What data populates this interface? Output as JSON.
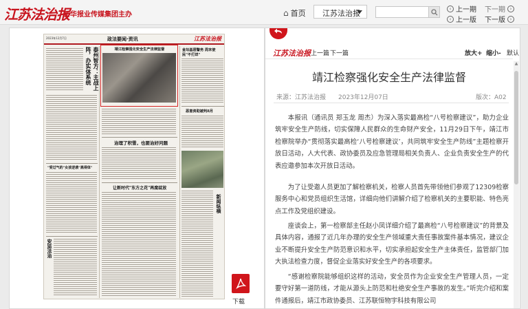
{
  "header": {
    "logo_text": "江苏法治报",
    "brand_text": "新华报业传媒集团主办",
    "home_label": "首页",
    "paper_select_value": "江苏法治报",
    "search_placeholder": "",
    "nav": {
      "prev_page": "上一期",
      "next_page": "下一期",
      "prev_edition": "上一版",
      "next_edition": "下一版"
    }
  },
  "newspaper": {
    "date_line": "2023年12月7日",
    "section_title": "政法要闻·资讯",
    "logo": "江苏法治报",
    "headlines": [
      "靖江检察强化安全生产法律监督",
      "金坛基层警务 周末使民\"不打烊\"",
      "恶意资助被判8月",
      "治理了积雪，也要治好问题",
      "让新时代\"东方之花\"再度绽放",
      "\"受过气的\"女孩逆袭\"高得体\"",
      "泰州智方：主战上阵，办实体系统",
      "安监法治",
      "新闻纵横"
    ]
  },
  "pdf": {
    "label": "下载"
  },
  "reader": {
    "logo": "江苏法治报",
    "prev_label": "上一篇",
    "next_label": "下一篇",
    "zoom_in": "放大+",
    "zoom_out": "缩小-",
    "zoom_default": "默认",
    "title": "靖江检察强化安全生产法律监督",
    "source": "来源：江苏法治报",
    "date": "2023年12月07日",
    "edition": "版次：A02",
    "paragraphs": [
      "本报讯（通讯员 郑玉龙 周杰）为深入落实最高检“八号检察建议”，助力企业筑牢安全生产防线，切实保障人民群众的生命财产安全，11月29日下午，靖江市检察院举办“贯彻落实最高检‘八号检察建议’，共同筑牢安全生产防线”主题检察开放日活动，人大代表、政协委员及应急管理局相关负责人、企业负责安全生产的代表应邀参加本次开放日活动。",
      "为了让受邀人员更加了解检察机关，检察人员首先带领他们参观了12309检察服务中心和党员组织生活馆，详细向他们讲解介绍了检察机关的主要职能、特色亮点工作及党组织建设。",
      "座谈会上，第一检察部主任赵小凤详细介绍了最高检“八号检察建议”的背景及具体内容，通报了近几年办理的安全生产领域重大责任事故案件基本情况，建议企业不断提升安全生产防范意识和水平，切实承担起安全生产主体责任，监管部门加大执法检查力度，督促企业落实好安全生产的各项要求。",
      "“感谢检察院能够组织这样的活动，安全员作为企业安全生产管理人员，一定要守好第一道防线，才能从源头上防范和杜绝安全生产事故的发生。”听完介绍和案件通报后，靖江市政协委员、江苏联恒物宇科技有限公司"
    ]
  }
}
